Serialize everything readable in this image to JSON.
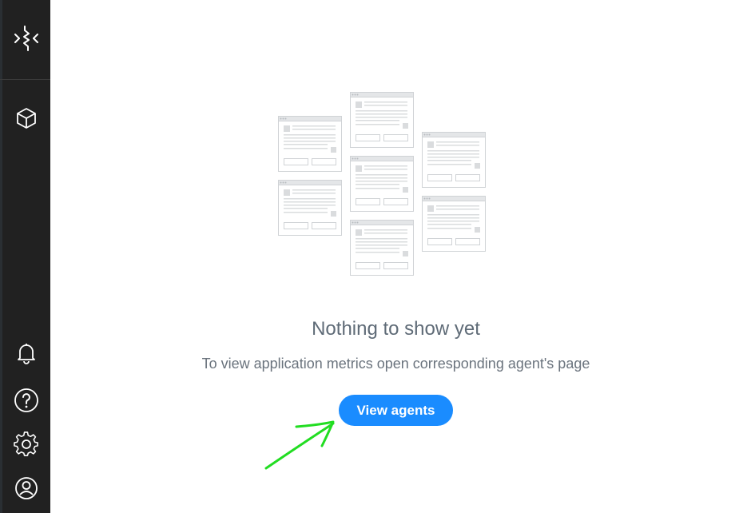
{
  "sidebar": {
    "items": [
      {
        "name": "logo-icon"
      },
      {
        "name": "cube-icon"
      },
      {
        "name": "bell-icon"
      },
      {
        "name": "help-icon"
      },
      {
        "name": "gear-icon"
      },
      {
        "name": "user-icon"
      }
    ]
  },
  "empty_state": {
    "title": "Nothing to show yet",
    "subtitle": "To view application metrics open corresponding agent's page",
    "button_label": "View agents"
  },
  "colors": {
    "sidebar": "#212121",
    "accent": "#1a8cff",
    "annotation": "#22dd22"
  }
}
